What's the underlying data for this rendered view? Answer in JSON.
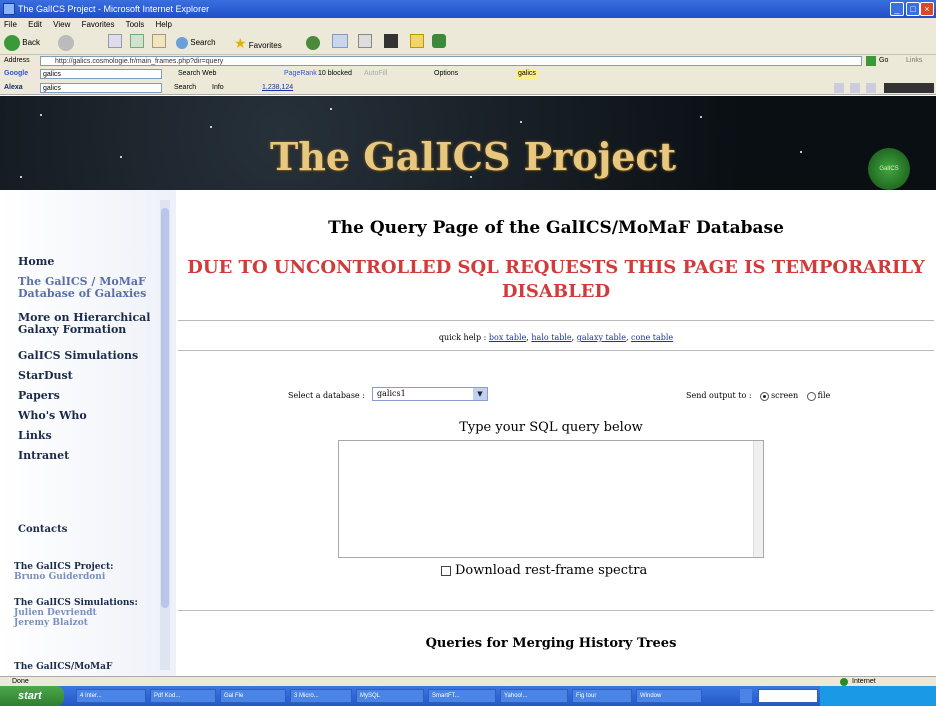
{
  "window": {
    "title": "The GalICS Project - Microsoft Internet Explorer"
  },
  "menubar": [
    "File",
    "Edit",
    "View",
    "Favorites",
    "Tools",
    "Help"
  ],
  "toolbar": {
    "back": "Back",
    "search": "Search",
    "favorites": "Favorites"
  },
  "address": {
    "label": "Address",
    "url": "http://galics.cosmologie.fr/main_frames.php?dir=query",
    "go": "Go",
    "links": "Links"
  },
  "googlebar": {
    "logo": "Google",
    "query": "galics",
    "search_web": "Search Web",
    "pagerank": "PageRank",
    "blocked": "10 blocked",
    "autofill": "AutoFill",
    "options": "Options",
    "highlight": "galics"
  },
  "alexabar": {
    "logo": "Alexa",
    "query": "galics",
    "search": "Search",
    "info": "Info",
    "rank": "1,238,124"
  },
  "banner": {
    "title": "The GalICS Project",
    "badge": "GalICS"
  },
  "sidebar": {
    "nav": [
      "Home",
      "The GalICS / MoMaF Database of Galaxies",
      "More on Hierarchical Galaxy Formation",
      "GalICS Simulations",
      "StarDust",
      "Papers",
      "Who's Who",
      "Links",
      "Intranet"
    ],
    "contacts_title": "Contacts",
    "contacts": [
      {
        "label": "The GalICS Project:",
        "names": [
          "Bruno Guiderdoni"
        ]
      },
      {
        "label": "The GalICS Simulations:",
        "names": [
          "Julien Devriendt",
          "Jeremy Blaizot"
        ]
      },
      {
        "label": "The GalICS/MoMaF",
        "names": []
      }
    ]
  },
  "main": {
    "title": "The Query Page of the GalICS/MoMaF Database",
    "alert": "DUE TO UNCONTROLLED SQL REQUESTS THIS PAGE IS TEMPORARILY DISABLED",
    "quickhelp_label": "quick help :",
    "quickhelp_links": [
      "box table",
      "halo table",
      "galaxy table",
      "cone table"
    ],
    "db_label": "Select a database :",
    "db_value": "galics1",
    "output_label": "Send output to :",
    "output_options": [
      "screen",
      "file"
    ],
    "output_selected": "screen",
    "sql_label": "Type your SQL query below",
    "download_label": "Download rest-frame spectra",
    "merge_title": "Queries for Merging History Trees"
  },
  "statusbar": {
    "left": "Done",
    "right": "Internet"
  },
  "taskbar": {
    "start": "start",
    "tasks": [
      "4 Inter...",
      "Pdf Kod...",
      "Gal Fle",
      "3 Micro...",
      "MySQL",
      "SmartFT...",
      "Yahoo!...",
      "Fig tour",
      "Window"
    ]
  }
}
